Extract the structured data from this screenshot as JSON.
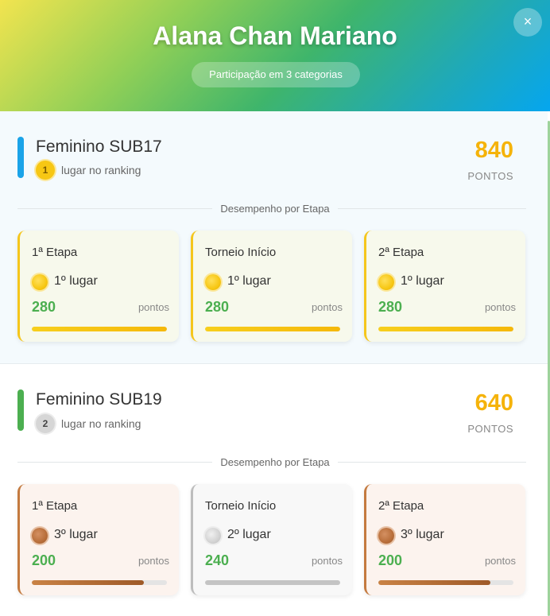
{
  "header": {
    "title": "Alana Chan Mariano",
    "subtitle": "Participação em 3 categorias",
    "close_label": "×"
  },
  "categories": [
    {
      "name": "Feminino SUB17",
      "accent_color": "#1aa3e8",
      "rank": "1",
      "rank_label": "lugar no ranking",
      "points": "840",
      "points_unit": "PONTOS",
      "divider_label": "Desempenho por Etapa",
      "stages": [
        {
          "name": "1ª Etapa",
          "place": "1º lugar",
          "points": "280",
          "unit": "pontos",
          "medal": "gold",
          "progress": 1.0
        },
        {
          "name": "Torneio Início",
          "place": "1º lugar",
          "points": "280",
          "unit": "pontos",
          "medal": "gold",
          "progress": 1.0
        },
        {
          "name": "2ª Etapa",
          "place": "1º lugar",
          "points": "280",
          "unit": "pontos",
          "medal": "gold",
          "progress": 1.0
        }
      ]
    },
    {
      "name": "Feminino SUB19",
      "accent_color": "#4caf50",
      "rank": "2",
      "rank_label": "lugar no ranking",
      "points": "640",
      "points_unit": "PONTOS",
      "divider_label": "Desempenho por Etapa",
      "stages": [
        {
          "name": "1ª Etapa",
          "place": "3º lugar",
          "points": "200",
          "unit": "pontos",
          "medal": "bronze",
          "progress": 0.83
        },
        {
          "name": "Torneio Início",
          "place": "2º lugar",
          "points": "240",
          "unit": "pontos",
          "medal": "silver",
          "progress": 1.0
        },
        {
          "name": "2ª Etapa",
          "place": "3º lugar",
          "points": "200",
          "unit": "pontos",
          "medal": "bronze",
          "progress": 0.83
        }
      ]
    }
  ],
  "colors": {
    "gold": "#f5c61c",
    "silver": "#bdbdbd",
    "bronze": "#c47a3f",
    "points": "#f5b30a",
    "stage_points": "#4caf50"
  }
}
